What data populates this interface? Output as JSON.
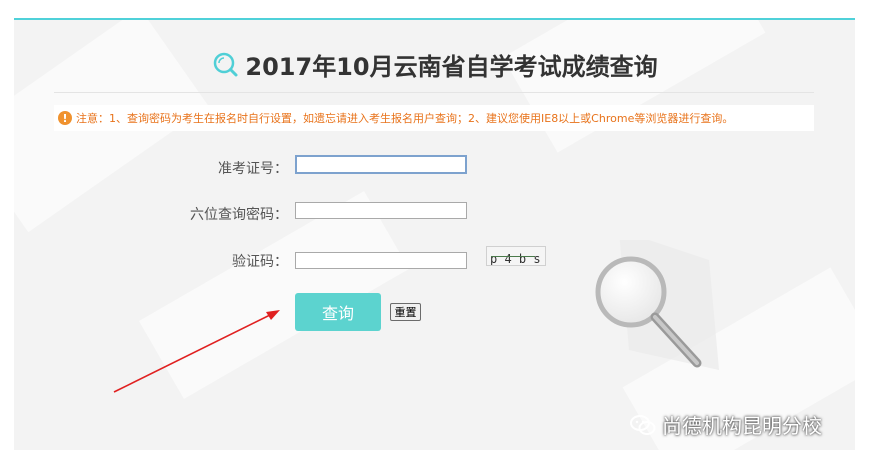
{
  "page": {
    "title": "2017年10月云南省自学考试成绩查询",
    "notice": "注意：1、查询密码为考生在报名时自行设置，如遗忘请进入考生报名用户查询；2、建议您使用IE8以上或Chrome等浏览器进行查询。"
  },
  "form": {
    "exam_id_label": "准考证号：",
    "exam_id_value": "",
    "password_label": "六位查询密码：",
    "password_value": "",
    "captcha_label": "验证码：",
    "captcha_value": "",
    "captcha_image_text": "p 4 b s",
    "query_button": "查询",
    "reset_button": "重置"
  },
  "watermark": {
    "text": "尚德机构昆明分校"
  },
  "colors": {
    "accent": "#5cd3cf",
    "top_border": "#4fd1d9",
    "notice_text": "#e8731b",
    "arrow": "#e02020"
  },
  "icons": {
    "title_icon": "search-icon",
    "notice_icon": "warning-icon",
    "decor_icon": "magnifying-glass-icon",
    "watermark_icon": "wechat-icon"
  }
}
